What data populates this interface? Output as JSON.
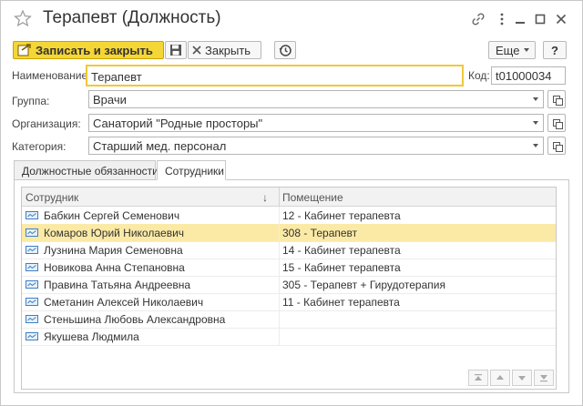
{
  "window": {
    "title": "Терапевт (Должность)",
    "icons": [
      "star-icon",
      "link-icon",
      "more-icon",
      "minimize-icon",
      "maximize-icon",
      "close-icon"
    ]
  },
  "toolbar": {
    "save_close_label": "Записать и закрыть",
    "close_label": "Закрыть",
    "more_label": "Еще",
    "help_label": "?"
  },
  "form": {
    "name_label": "Наименование:",
    "name_value": "Терапевт",
    "code_label": "Код:",
    "code_value": "t01000034",
    "group_label": "Группа:",
    "group_value": "Врачи",
    "org_label": "Организация:",
    "org_value": "Санаторий \"Родные просторы\"",
    "category_label": "Категория:",
    "category_value": "Старший мед. персонал"
  },
  "tabs": [
    {
      "label": "Должностные обязанности",
      "active": false
    },
    {
      "label": "Сотрудники",
      "active": true
    }
  ],
  "table": {
    "columns": [
      "Сотрудник",
      "Помещение"
    ],
    "sort_indicator": "↓",
    "rows": [
      {
        "employee": "Бабкин Сергей Семенович",
        "room": "12 - Кабинет терапевта",
        "selected": false
      },
      {
        "employee": "Комаров Юрий Николаевич",
        "room": "308 - Терапевт",
        "selected": true
      },
      {
        "employee": "Лузнина Мария Семеновна",
        "room": "14 - Кабинет терапевта",
        "selected": false
      },
      {
        "employee": "Новикова Анна Степановна",
        "room": "15 - Кабинет терапевта",
        "selected": false
      },
      {
        "employee": "Правина Татьяна Андреевна",
        "room": "305 - Терапевт + Гирудотерапия",
        "selected": false
      },
      {
        "employee": "Сметанин Алексей Николаевич",
        "room": "11 - Кабинет терапевта",
        "selected": false
      },
      {
        "employee": "Стеньшина Любовь Александровна",
        "room": "",
        "selected": false
      },
      {
        "employee": "Якушева Людмила",
        "room": "",
        "selected": false
      }
    ]
  },
  "colors": {
    "accent": "#f5d637",
    "selection": "#fbeaa6",
    "border": "#c8c8c8"
  }
}
